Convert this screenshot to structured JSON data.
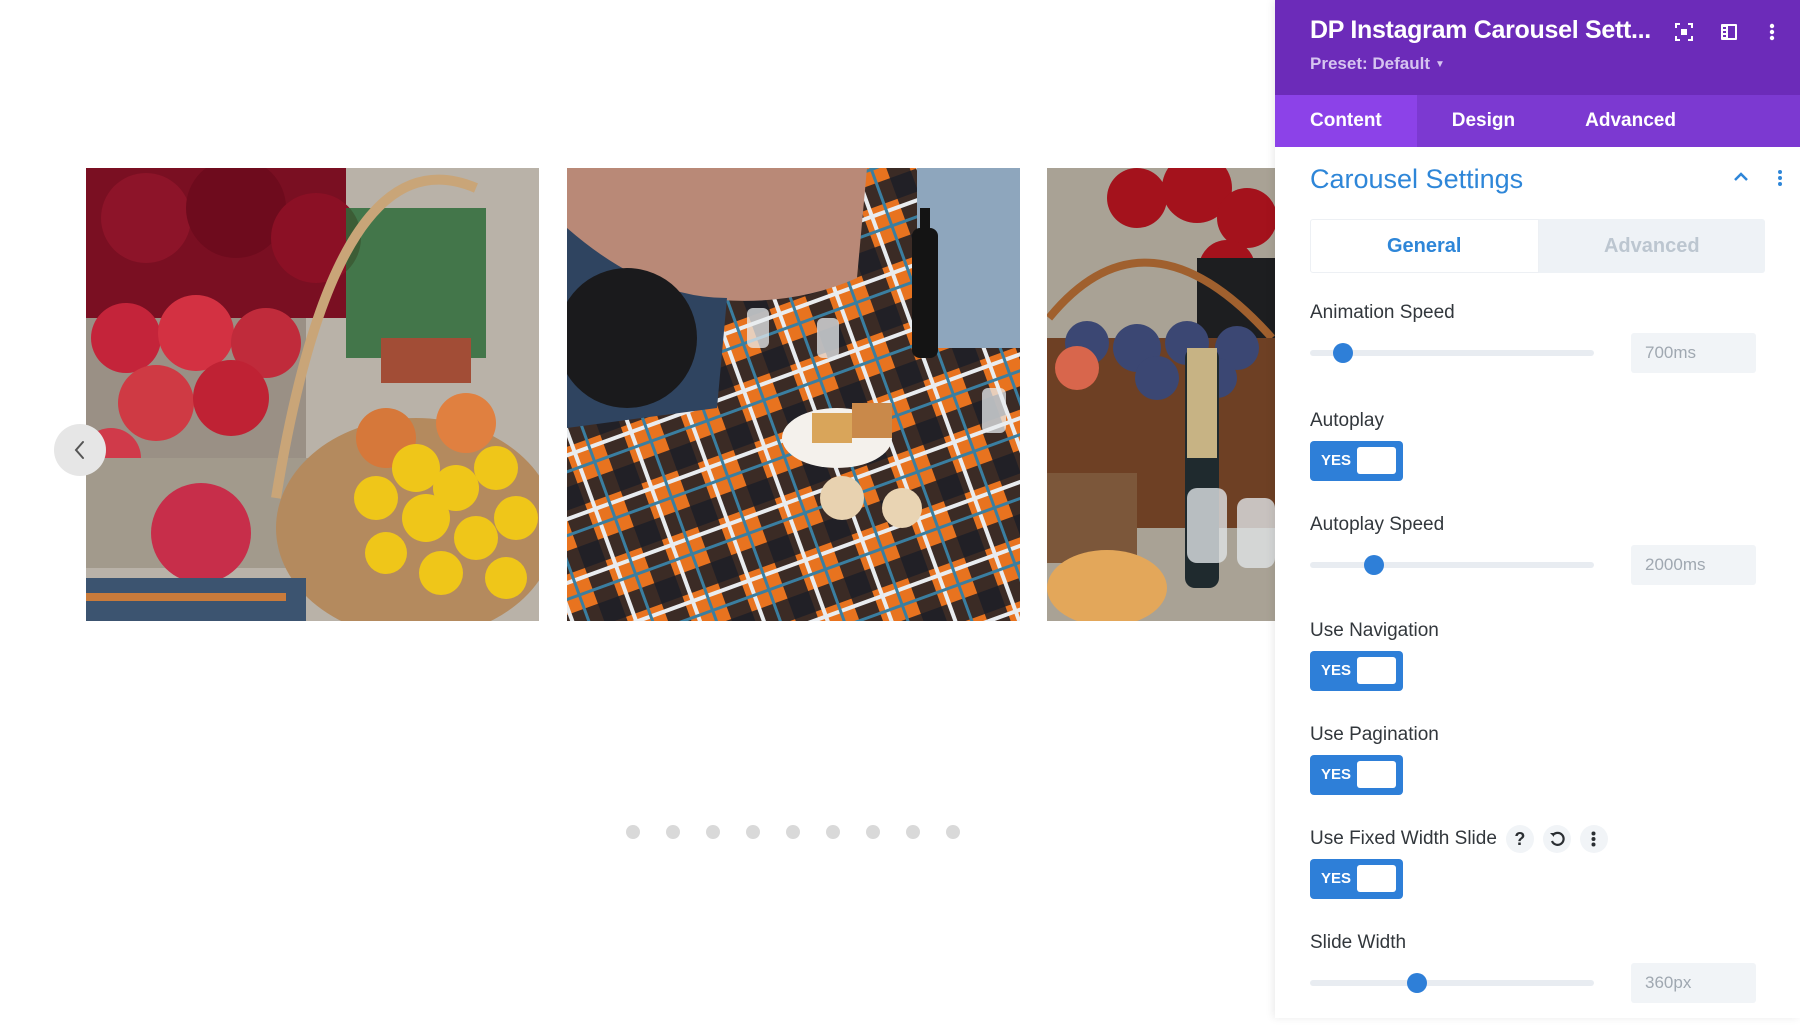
{
  "carousel": {
    "slides": [
      {
        "alt": "Basket of apples, pomegranate and yellow chrysanthemums"
      },
      {
        "alt": "Picnic on orange plaid blanket with wine and glasses"
      },
      {
        "alt": "Wicker basket of plums with champagne bottle and cake"
      }
    ],
    "prev_icon": "chevron-left-icon",
    "pagination_count": 9
  },
  "panel": {
    "title": "DP Instagram Carousel Sett...",
    "preset": "Preset: Default",
    "header_icons": [
      "focus-icon",
      "split-view-icon",
      "more-vertical-icon"
    ],
    "tabs": [
      {
        "label": "Content",
        "active": true
      },
      {
        "label": "Design",
        "active": false
      },
      {
        "label": "Advanced",
        "active": false
      }
    ],
    "group": {
      "title": "Carousel Settings",
      "subtabs": [
        {
          "label": "General",
          "active": true
        },
        {
          "label": "Advanced",
          "active": false
        }
      ]
    },
    "fields": {
      "animation_speed": {
        "label": "Animation Speed",
        "value": "700ms",
        "slider_fraction": 0.08
      },
      "autoplay": {
        "label": "Autoplay",
        "toggle": "YES"
      },
      "autoplay_speed": {
        "label": "Autoplay Speed",
        "value": "2000ms",
        "slider_fraction": 0.19
      },
      "use_navigation": {
        "label": "Use Navigation",
        "toggle": "YES"
      },
      "use_pagination": {
        "label": "Use Pagination",
        "toggle": "YES"
      },
      "use_fixed_width_slide": {
        "label": "Use Fixed Width Slide",
        "toggle": "YES",
        "help": "?"
      },
      "slide_width": {
        "label": "Slide Width",
        "value": "360px",
        "slider_fraction": 0.34
      }
    }
  },
  "colors": {
    "header": "#6c2bb9",
    "tab_bar": "#7c39d1",
    "tab_active": "#8c42e8",
    "accent_blue": "#2e7fd8"
  }
}
